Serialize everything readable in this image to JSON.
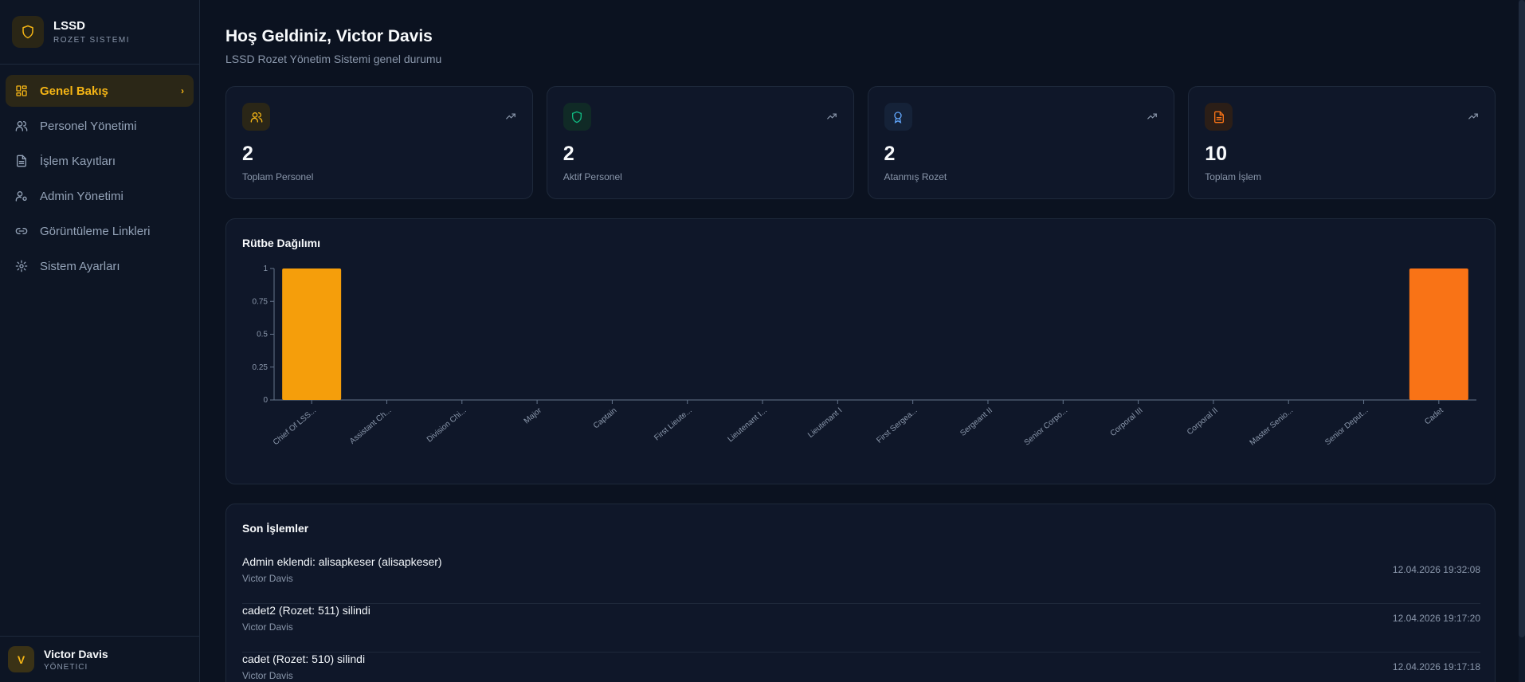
{
  "brand": {
    "title": "LSSD",
    "subtitle": "ROZET SISTEMI",
    "logo_icon": "shield-icon",
    "accent": "#f5b515"
  },
  "nav": [
    {
      "label": "Genel Bakış",
      "icon": "dashboard-icon",
      "active": true
    },
    {
      "label": "Personel Yönetimi",
      "icon": "users-icon"
    },
    {
      "label": "İşlem Kayıtları",
      "icon": "file-icon"
    },
    {
      "label": "Admin Yönetimi",
      "icon": "user-cog-icon"
    },
    {
      "label": "Görüntüleme Linkleri",
      "icon": "link-icon"
    },
    {
      "label": "Sistem Ayarları",
      "icon": "gear-icon"
    }
  ],
  "user": {
    "initial": "V",
    "name": "Victor Davis",
    "role": "YÖNETICI"
  },
  "header": {
    "title": "Hoş Geldiniz, Victor Davis",
    "subtitle": "LSSD Rozet Yönetim Sistemi genel durumu"
  },
  "stats": [
    {
      "value": "2",
      "label": "Toplam Personel",
      "icon": "users-icon",
      "color": "#f5b515",
      "bg": "#2a2617"
    },
    {
      "value": "2",
      "label": "Aktif Personel",
      "icon": "shield-icon",
      "color": "#10b981",
      "bg": "#102a26"
    },
    {
      "value": "2",
      "label": "Atanmış Rozet",
      "icon": "award-icon",
      "color": "#60a5fa",
      "bg": "#152238"
    },
    {
      "value": "10",
      "label": "Toplam İşlem",
      "icon": "file-icon",
      "color": "#f97316",
      "bg": "#2b1e17"
    }
  ],
  "chart_card": {
    "title": "Rütbe Dağılımı"
  },
  "chart_data": {
    "type": "bar",
    "title": "Rütbe Dağılımı",
    "categories": [
      "Chief Of LSS...",
      "Assistant Ch...",
      "Division Chi...",
      "Major",
      "Captain",
      "First Lieute...",
      "Lieutenant I...",
      "Lieutenant I",
      "First Sergea...",
      "Sergeant II",
      "Senior Corpo...",
      "Corporal III",
      "Corporal II",
      "Master Senio...",
      "Senior Deput...",
      "Cadet"
    ],
    "values": [
      1,
      0,
      0,
      0,
      0,
      0,
      0,
      0,
      0,
      0,
      0,
      0,
      0,
      0,
      0,
      1
    ],
    "bar_colors": [
      "#f59e0b",
      "#f59e0b",
      "#f59e0b",
      "#f59e0b",
      "#f59e0b",
      "#f59e0b",
      "#f59e0b",
      "#f59e0b",
      "#f59e0b",
      "#f59e0b",
      "#f59e0b",
      "#f59e0b",
      "#f59e0b",
      "#f59e0b",
      "#f59e0b",
      "#f97316"
    ],
    "yticks": [
      "0",
      "0.25",
      "0.5",
      "0.75",
      "1"
    ],
    "ylim": [
      0,
      1
    ],
    "grid": false
  },
  "recent": {
    "title": "Son İşlemler",
    "items": [
      {
        "title": "Admin eklendi: alisapkeser (alisapkeser)",
        "user": "Victor Davis",
        "time": "12.04.2026 19:32:08"
      },
      {
        "title": "cadet2 (Rozet: 511) silindi",
        "user": "Victor Davis",
        "time": "12.04.2026 19:17:20"
      },
      {
        "title": "cadet (Rozet: 510) silindi",
        "user": "Victor Davis",
        "time": "12.04.2026 19:17:18"
      }
    ]
  }
}
